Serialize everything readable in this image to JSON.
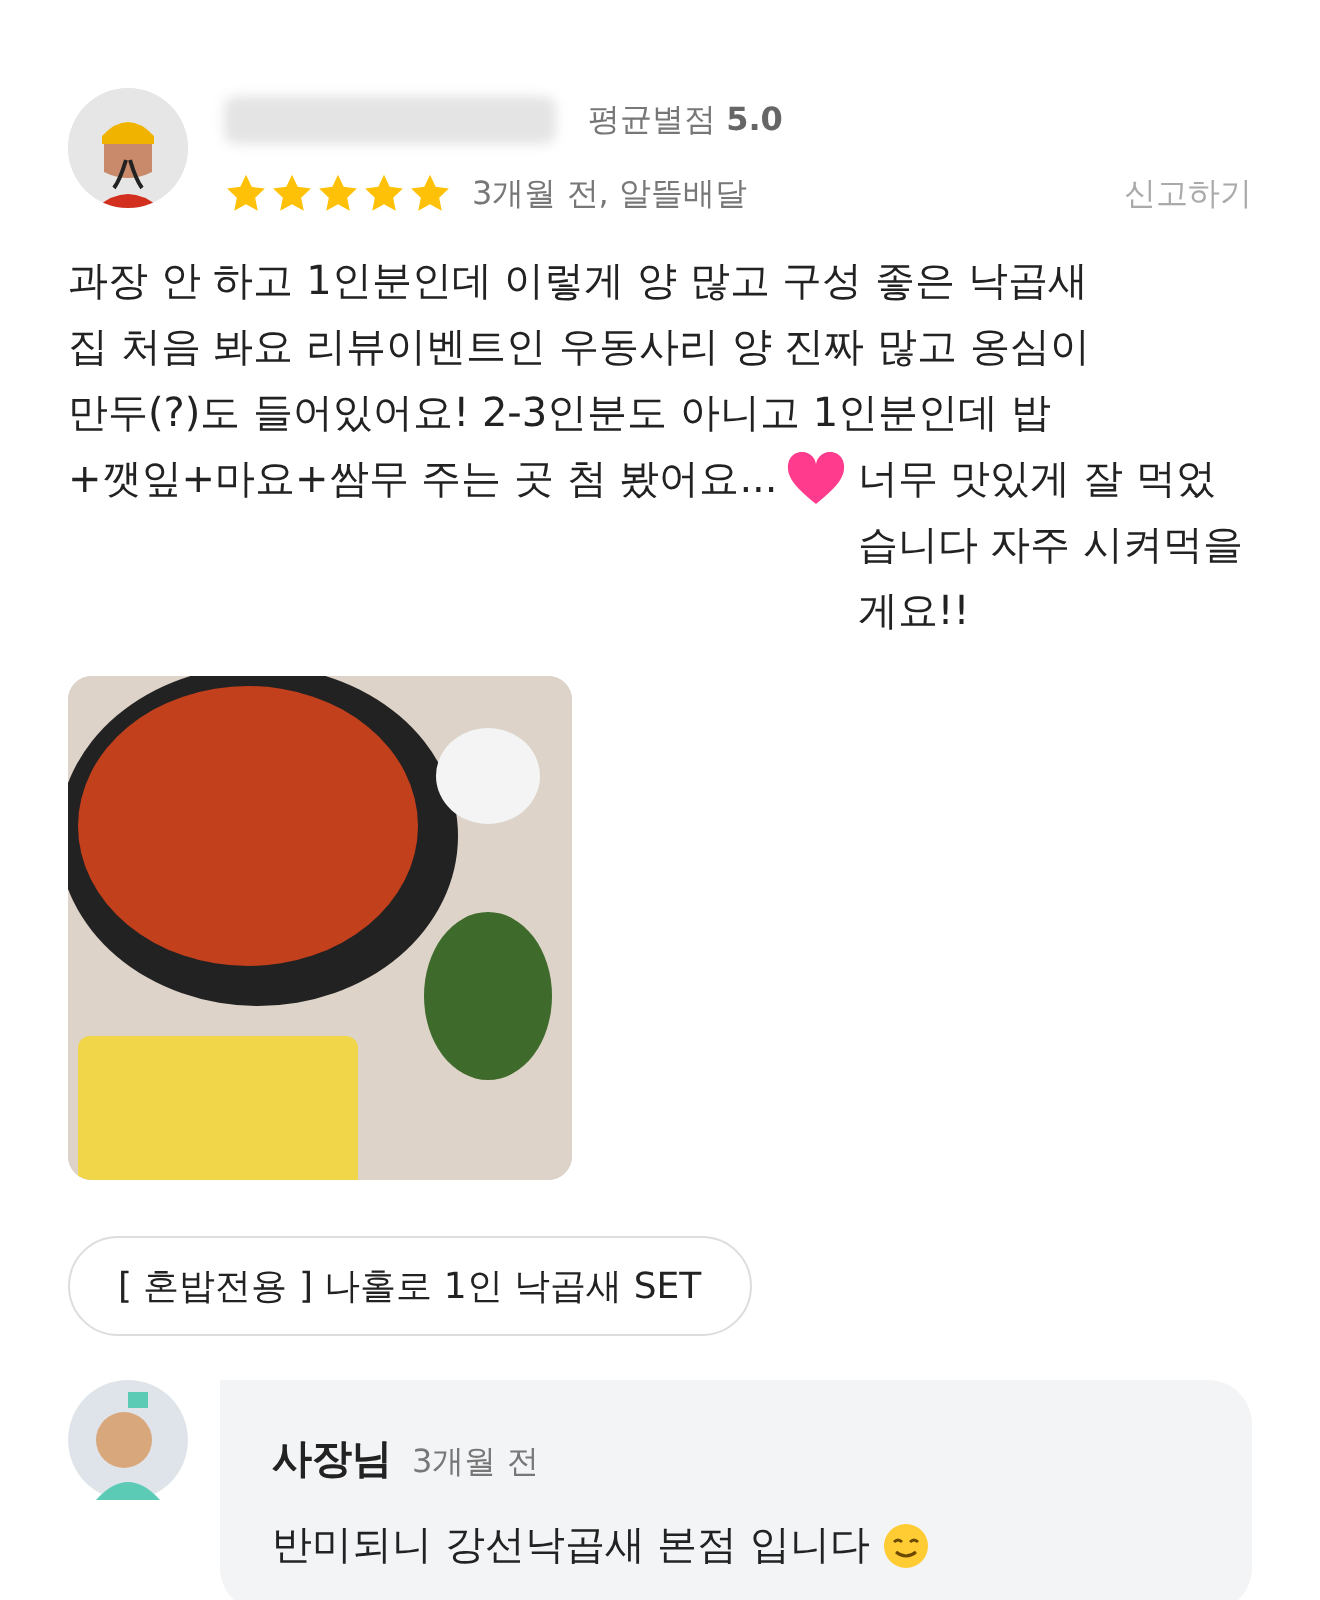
{
  "review": {
    "rating_label": "평균별점",
    "rating_value": "5.0",
    "stars": 5,
    "meta": "3개월 전, 알뜰배달",
    "report": "신고하기",
    "text_lines": [
      "과장 안 하고 1인분인데 이렇게 양 많고 구성 좋은 낙곱새",
      "집 처음 봐요 리뷰이벤트인 우동사리 양 진짜 많고 옹심이",
      "만두(?)도 들어있어요! 2-3인분도 아니고 1인분인데 밥",
      "+깻잎+마요+쌈무 주는 곳 첨 봤어요..."
    ],
    "text_end": "너무 맛있게 잘 먹었습니다 자주 시켜먹을게요!!",
    "menu_tag": "[ 혼밥전용 ] 나홀로 1인 낙곱새 SET"
  },
  "reply": {
    "author": "사장님",
    "time": "3개월 전",
    "text": "반미되니 강선낙곱새 본점 입니다"
  }
}
